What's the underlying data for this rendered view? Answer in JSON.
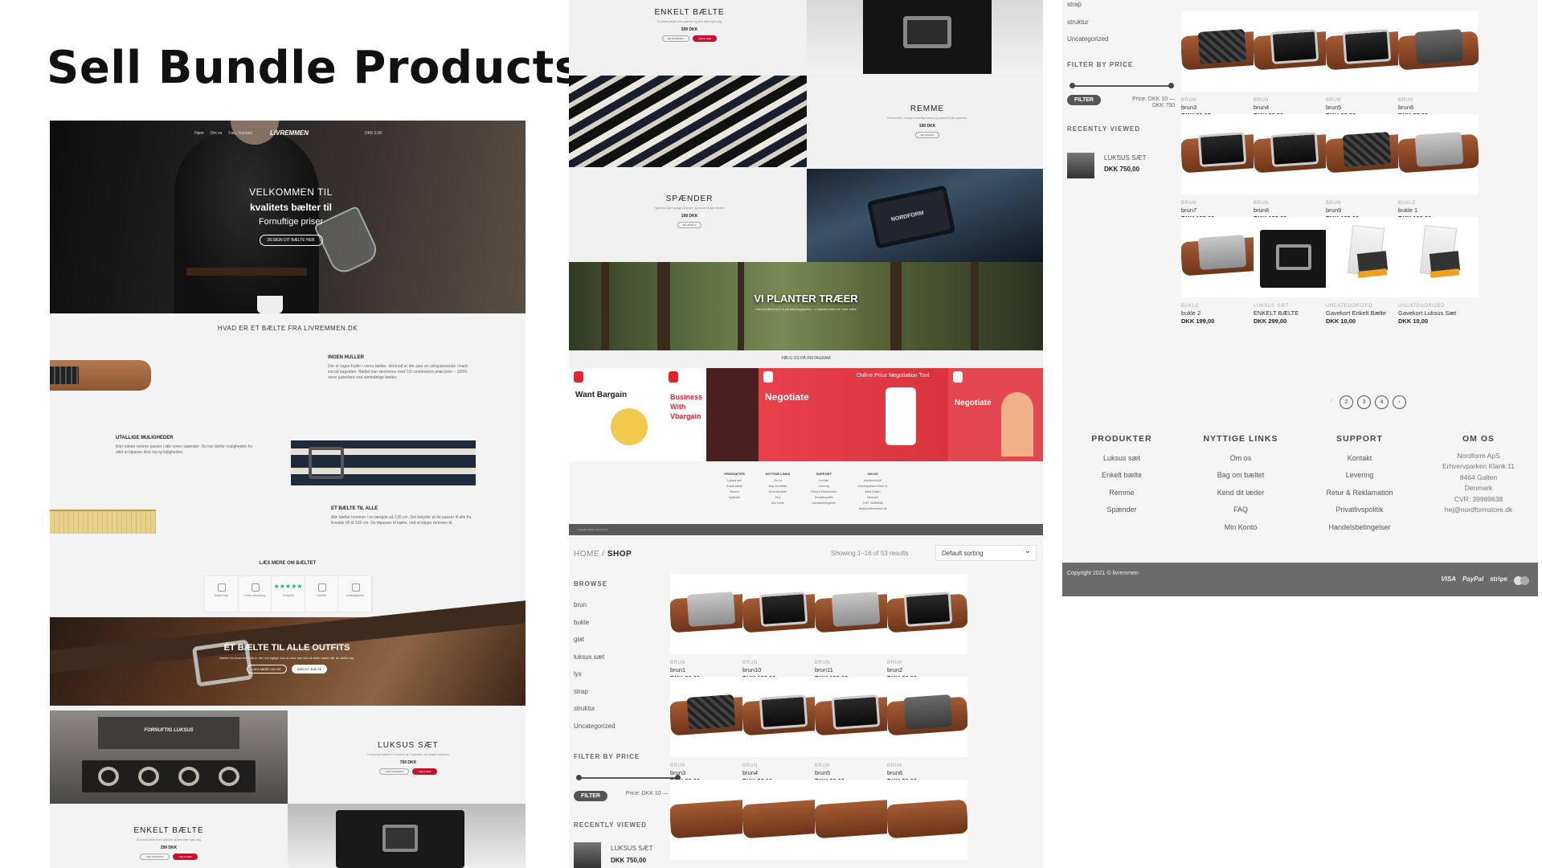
{
  "headline": "Sell Bundle Products",
  "hero": {
    "nav": [
      "Hjem",
      "Om os",
      "Faq / Kontakt"
    ],
    "logo": "LIVREMMEN",
    "cart": "DKK 0,00",
    "line1": "VELKOMMEN TIL",
    "line2": "kvalitets bælter til",
    "line3": "Fornuftige priser",
    "button": "DESIGN DIT BÆLTE HER"
  },
  "home": {
    "section_title": "HVAD ER ET BÆLTE FRA LIVREMMEN.DK",
    "f1_title": "INGEN HULLER",
    "f1_text": "Der er ingen huller i vores bælter, derimod er det spor en selvjusterende i track ind på bagsiden. Bæltet kan strammes med 0,5 centimeters præcision – 100% mere justerbart end almindelige bælter.",
    "f2_title": "UTALLIGE MULIGHEDER",
    "f2_text": "Kört ndelet remme passer i alle vores spænder. Du har derfor muligheden for altid at tilpasse dine tøj og lejligheden.",
    "f3_title": "ET BÆLTE TIL ALLE",
    "f3_text": "Alle bælter kommer i en længde på 130 cm. Det betyder at de passer til alle fra livvidde 65 til 130 cm. Du tilpasser til bælte, ved at klippe remmen til.",
    "read_more": "LÆS MERE OM BÆLTET",
    "features": [
      "Gratis fragt",
      "Lover retrunerng",
      "Trustpilot",
      "Kvalitet",
      "Livstidsgaranti"
    ],
    "stars": "★★★★★",
    "banner_title": "ÉT BÆLTE TIL ALLE OUTFITS",
    "banner_sub": "Bælter fra livremmen.dk er det helt rigtige hvis du ikke kan lide at skifte bælte når du skifter tøj.",
    "banner_btn1": "LÆS MERE OM OS",
    "banner_btn2": "KØB DIT BÆLTE",
    "box_brand": "FORNUFTIG LUKSUS",
    "luksus_name": "LUKSUS SÆT",
    "luksus_desc": "Livremmen sættet til 3 remme og 3 spænder, der passer sammen",
    "luksus_price": "750 DKK",
    "btn_read": "LÆS SANDSIGT",
    "btn_buy": "VÆLG HER",
    "enkelt_name": "ENKELT BÆLTE",
    "enkelt_desc": "Et enkelt bælte med spænde og rem efter eget valg",
    "enkelt_price": "299 DKK"
  },
  "panel2": {
    "enkelt_name": "ENKELT BÆLTE",
    "enkelt_desc": "Et enkelt bælte med spænde og rem efter eget valg",
    "enkelt_price": "299 DKK",
    "btn_read": "SE SANDSIGT",
    "btn_buy": "VÆLG HER",
    "remme_name": "REMME",
    "remme_desc": "Remme fås i mange forskellige farver og passer til alle spænder.",
    "remme_price": "199 DKK",
    "remme_btn": "SE UDVALG",
    "spaender_name": "SPÆNDER",
    "spaender_desc": "Spænder fås i mange varianter og passer til alle remme.",
    "spaender_price": "199 DKK",
    "spaender_btn": "SE UDVALG",
    "buckle_brand": "NORDFORM",
    "forest_title": "VI PLANTER TRÆER",
    "forest_sub": "Hos Nordform tror vi på bæredygtighed – vi planter træer for hver ordre",
    "insta_heading": "FØLG OS PÅ INSTAGRAM",
    "insta1": "Want Bargain",
    "insta2": "Business With Vbargain",
    "insta3": "Negotiate",
    "insta4": "Online Price Negotiation Tool",
    "insta5": "Negotiate",
    "foot_cols": [
      {
        "h": "PRODUKTER",
        "items": [
          "Luksus sæt",
          "Enkelt bælte",
          "Remme",
          "Spænder"
        ]
      },
      {
        "h": "NYTTIGE LINKS",
        "items": [
          "Om os",
          "Bag om bæltet",
          "Kend dit læder",
          "FAQ",
          "Min Konto"
        ]
      },
      {
        "h": "SUPPORT",
        "items": [
          "Kontakt",
          "Levering",
          "Retur & Reklamation",
          "Privatlivspolitik",
          "Handelsbetingelser"
        ]
      },
      {
        "h": "OM OS",
        "items": [
          "Nordform ApS",
          "Erhvervparken Klank 11",
          "8464 Galten",
          "Denmark",
          "CVR: 39989638",
          "hej@nordformstore.dk"
        ]
      }
    ],
    "copyright": "Copyright 2021 © livremmen"
  },
  "shop": {
    "crumb_home": "HOME",
    "crumb_sep": "/",
    "crumb_current": "SHOP",
    "showing": "Showing 1–16 of 53 results",
    "sort": "Default sorting",
    "browse_title": "BROWSE",
    "categories": [
      "brun",
      "bukle",
      "glat",
      "luksus sæt",
      "lys",
      "strap",
      "struktur",
      "Uncategorized"
    ],
    "filter_title": "FILTER BY PRICE",
    "filter_btn": "FILTER",
    "price_label": "Price:",
    "price_range": "DKK 10 — DKK 750",
    "recent_title": "RECENTLY VIEWED",
    "recent_name": "LUKSUS SÆT",
    "recent_price": "DKK 750,00",
    "products_row1": [
      {
        "cat": "BRUN",
        "name": "brun1",
        "price": "DKK 30,00"
      },
      {
        "cat": "BRUN",
        "name": "brun10",
        "price": "DKK 199,00"
      },
      {
        "cat": "BRUN",
        "name": "brun11",
        "price": "DKK 199,00"
      },
      {
        "cat": "BRUN",
        "name": "brun2",
        "price": "DKK 30,00"
      }
    ],
    "products_row2": [
      {
        "cat": "BRUN",
        "name": "brun3",
        "price": "DKK 30,00"
      },
      {
        "cat": "BRUN",
        "name": "brun4",
        "price": "DKK 30,00"
      },
      {
        "cat": "BRUN",
        "name": "brun5",
        "price": "DKK 30,00"
      },
      {
        "cat": "BRUN",
        "name": "brun6",
        "price": "DKK 30,00"
      }
    ]
  },
  "panel3": {
    "categories": [
      "strap",
      "struktur",
      "Uncategorized"
    ],
    "filter_title": "FILTER BY PRICE",
    "filter_btn": "FILTER",
    "price_label": "Price: DKK 10 —",
    "price_max": "DKK 750",
    "recent_title": "RECENTLY VIEWED",
    "recent_name": "LUKSUS SÆT",
    "recent_price": "DKK 750,00",
    "products": [
      {
        "cat": "BRUN",
        "name": "brun3",
        "price": "DKK 30,00"
      },
      {
        "cat": "BRUN",
        "name": "brun4",
        "price": "DKK 30,00"
      },
      {
        "cat": "BRUN",
        "name": "brun5",
        "price": "DKK 30,00"
      },
      {
        "cat": "BRUN",
        "name": "brun6",
        "price": "DKK 30,00"
      },
      {
        "cat": "BRUN",
        "name": "brun7",
        "price": "DKK 199,00"
      },
      {
        "cat": "BRUN",
        "name": "brun8",
        "price": "DKK 199,00"
      },
      {
        "cat": "BRUN",
        "name": "brun9",
        "price": "DKK 199,00"
      },
      {
        "cat": "BUKLE",
        "name": "bukle 1",
        "price": "DKK 199,00"
      },
      {
        "cat": "BUKLE",
        "name": "bukle 2",
        "price": "DKK 199,00"
      },
      {
        "cat": "LUKSUS SÆT",
        "name": "ENKELT BÆLTE",
        "price": "DKK 299,00"
      },
      {
        "cat": "UNCATEGORIZED",
        "name": "Gavekort Enkelt Bælte",
        "price": "DKK 10,00"
      },
      {
        "cat": "UNCATEGORIZED",
        "name": "Gavekort Luksus Sæt",
        "price": "DKK 10,00"
      }
    ],
    "pages": [
      "2",
      "3",
      "4",
      "›"
    ],
    "foot": [
      {
        "h": "PRODUKTER",
        "items": [
          "Luksus sæt",
          "Enkelt bælte",
          "Remme",
          "Spænder"
        ]
      },
      {
        "h": "NYTTIGE LINKS",
        "items": [
          "Om os",
          "Bag om bæltet",
          "Kend dit læder",
          "FAQ",
          "Min Konto"
        ]
      },
      {
        "h": "SUPPORT",
        "items": [
          "Kontakt",
          "Levering",
          "Retur & Reklamation",
          "Privatlivspolitik",
          "Handelsbetingelser"
        ]
      },
      {
        "h": "OM OS",
        "items": [
          "Nordform ApS",
          "Erhvervparken Klank 11",
          "8464 Galten",
          "Denmark",
          "CVR: 39989638",
          "hej@nordformstore.dk"
        ]
      }
    ],
    "copyright": "Copyright 2021 © livremmen",
    "payments": [
      "VISA",
      "PayPal",
      "stripe"
    ]
  },
  "colors": {
    "accent": "#c8102e",
    "footer_bar": "#6b6b6b",
    "shop_bg": "#f5f5f5"
  }
}
